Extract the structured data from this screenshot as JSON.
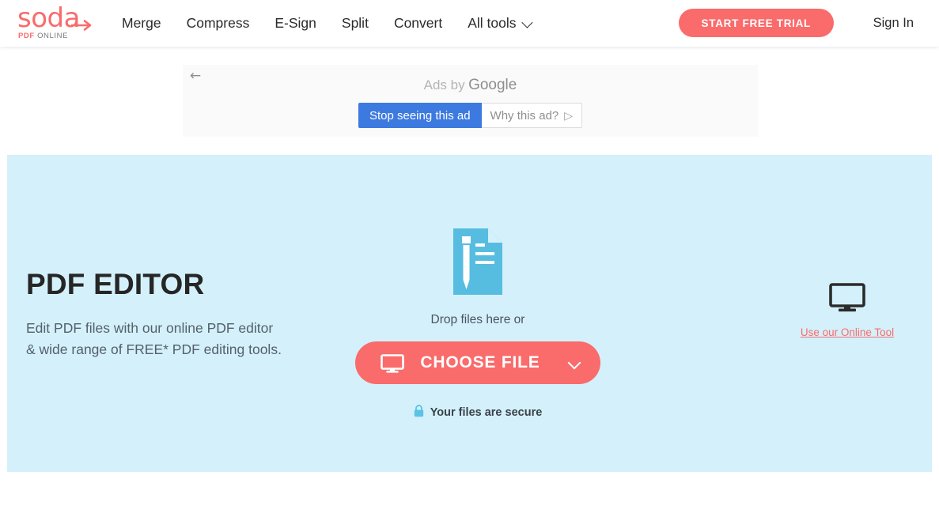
{
  "header": {
    "logo": {
      "word": "soda",
      "sub_pdf": "PDF",
      "sub_online": "ONLINE",
      "arrow_icon": "arrow-right-icon"
    },
    "nav": [
      {
        "label": "Merge",
        "name": "nav-merge"
      },
      {
        "label": "Compress",
        "name": "nav-compress"
      },
      {
        "label": "E-Sign",
        "name": "nav-esign"
      },
      {
        "label": "Split",
        "name": "nav-split"
      },
      {
        "label": "Convert",
        "name": "nav-convert"
      },
      {
        "label": "All tools",
        "name": "nav-all-tools",
        "icon": "chevron-down-icon"
      }
    ],
    "trial_button": "START FREE TRIAL",
    "signin": "Sign In"
  },
  "ad": {
    "back_icon": "arrow-left-icon",
    "by_prefix": "Ads by",
    "by_brand": "Google",
    "stop_button": "Stop seeing this ad",
    "why_button": "Why this ad?",
    "why_icon": "play-triangle-icon"
  },
  "hero": {
    "title": "PDF EDITOR",
    "subtitle_line1": "Edit PDF files with our online PDF editor",
    "subtitle_line2": "& wide range of FREE* PDF editing tools.",
    "doc_icon": "pdf-edit-document-icon",
    "drop_text": "Drop files here or",
    "choose_button": "CHOOSE FILE",
    "choose_icon": "monitor-icon",
    "choose_chevron": "chevron-down-icon",
    "secure_text": "Your files are secure",
    "secure_icon": "lock-icon",
    "online_tool_icon": "monitor-icon",
    "online_tool_link": "Use our Online Tool"
  },
  "colors": {
    "brand_coral": "#fa6b6b",
    "hero_bg": "#d4f1fb",
    "doc_blue": "#57bde0",
    "ad_blue": "#3d7ae0",
    "text_dark": "#262626"
  }
}
